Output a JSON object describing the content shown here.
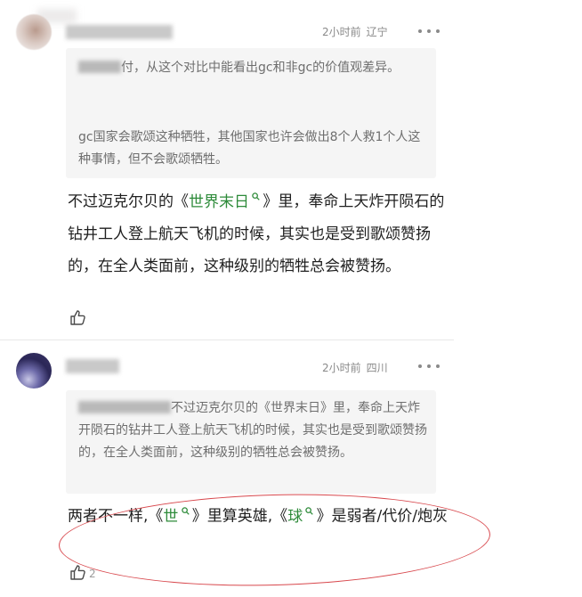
{
  "comments": [
    {
      "time": "2小时前",
      "location": "辽宁",
      "quote": {
        "para1": "付，从这个对比中能看出gc和非gc的价值观差异。",
        "para2": "gc国家会歌颂这种牺牲，其他国家也许会做出8个人救1个人这种事情，但不会歌颂牺牲。"
      },
      "body": {
        "before": "不过迈克尔贝的《",
        "mention": "世界末日",
        "after": "》里，奉命上天炸开陨石的钻井工人登上航天飞机的时候，其实也是受到歌颂赞扬的，在全人类面前，这种级别的牺牲总会被赞扬。"
      },
      "likes": ""
    },
    {
      "time": "2小时前",
      "location": "四川",
      "quote": {
        "para1": "不过迈克尔贝的《世界末日》里，奉命上天炸开陨石的钻井工人登上航天飞机的时候，其实也是受到歌颂赞扬的，在全人类面前，这种级别的牺牲总会被赞扬。"
      },
      "body": {
        "p1": "两者不一样,《",
        "m1": "世",
        "p2": "》里算英雄,《",
        "m2": "球",
        "p3": "》是弱者/代价/炮灰"
      },
      "likes": "2"
    }
  ],
  "colors": {
    "mention": "#2e8b3a",
    "annotation_oval": "#d8484d"
  },
  "icons": {
    "more": "more-dots-icon",
    "like": "thumbs-up-icon",
    "search": "search-icon"
  }
}
